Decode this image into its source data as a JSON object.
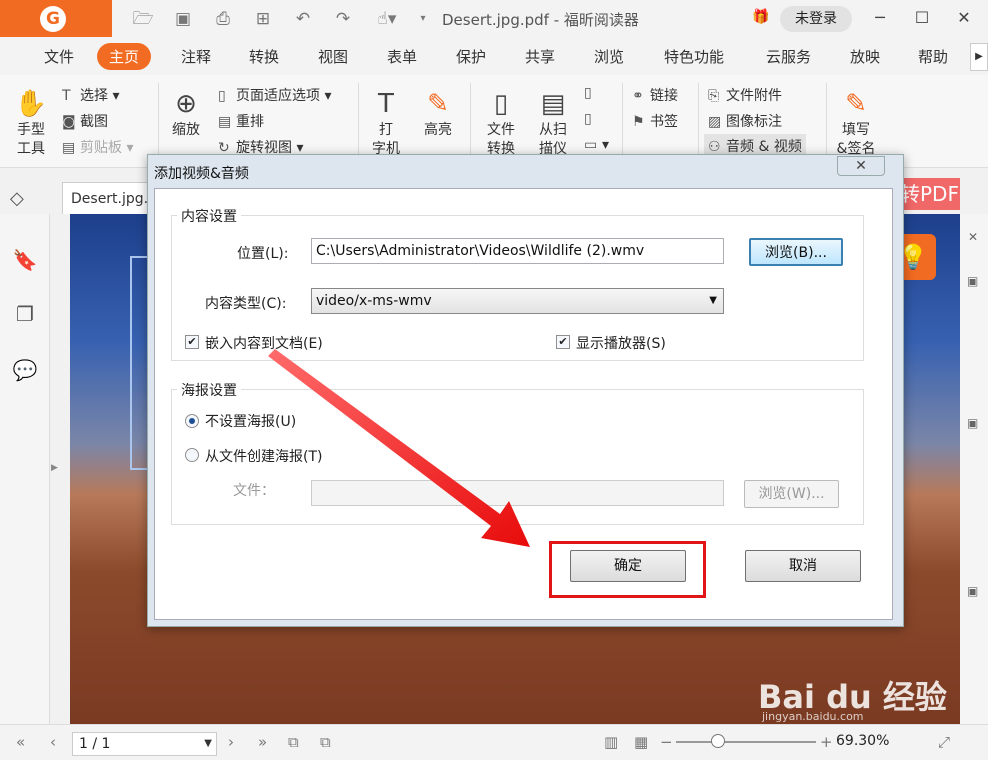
{
  "app": {
    "doc_title": "Desert.jpg.pdf - 福昕阅读器",
    "login_label": "未登录",
    "logo_letter": "G"
  },
  "menu": {
    "items": [
      "文件",
      "主页",
      "注释",
      "转换",
      "视图",
      "表单",
      "保护",
      "共享",
      "浏览",
      "特色功能",
      "云服务",
      "放映",
      "帮助"
    ],
    "active": "主页"
  },
  "ribbon": {
    "hand_tool": [
      "手型",
      "工具"
    ],
    "select": "选择",
    "screenshot": "截图",
    "clipboard": "剪贴板",
    "zoom": "缩放",
    "page_fit": "页面适应选项",
    "reflow": "重排",
    "rotate_view": "旋转视图",
    "typewriter": [
      "打",
      "字机"
    ],
    "highlight": "高亮",
    "file_convert": [
      "文件",
      "转换"
    ],
    "from_scanner": [
      "从扫",
      "描仪"
    ],
    "link": "链接",
    "bookmark": "书签",
    "file_attachment": "文件附件",
    "image_annotation": "图像标注",
    "audio_video": "音频 & 视频",
    "fill_sign": [
      "填写",
      "&签名"
    ]
  },
  "tabs": {
    "file_tab": "Desert.jpg..."
  },
  "banner": {
    "text": "转PDF"
  },
  "dialog": {
    "title": "添加视频&音频",
    "content_group": "内容设置",
    "location_label": "位置(L):",
    "location_value": "C:\\Users\\Administrator\\Videos\\Wildlife (2).wmv",
    "browse_label": "浏览(B)...",
    "content_type_label": "内容类型(C):",
    "content_type_value": "video/x-ms-wmv",
    "embed_label": "嵌入内容到文档(E)",
    "embed_checked": true,
    "show_player_label": "显示播放器(S)",
    "show_player_checked": true,
    "poster_group": "海报设置",
    "no_poster_label": "不设置海报(U)",
    "from_file_poster_label": "从文件创建海报(T)",
    "poster_selected": "no_poster",
    "file_label": "文件：",
    "file_value": "",
    "browse_w_label": "浏览(W)...",
    "ok_label": "确定",
    "cancel_label": "取消"
  },
  "statusbar": {
    "page_value": "1 / 1",
    "zoom_value": "69.30%",
    "zoom_level_fraction": 0.3
  },
  "watermark": {
    "text": "Bai du 经验",
    "url": "jingyan.baidu.com"
  },
  "colors": {
    "accent": "#f26b22",
    "highlight_box": "#e01515",
    "banner": "#f15a5a"
  }
}
